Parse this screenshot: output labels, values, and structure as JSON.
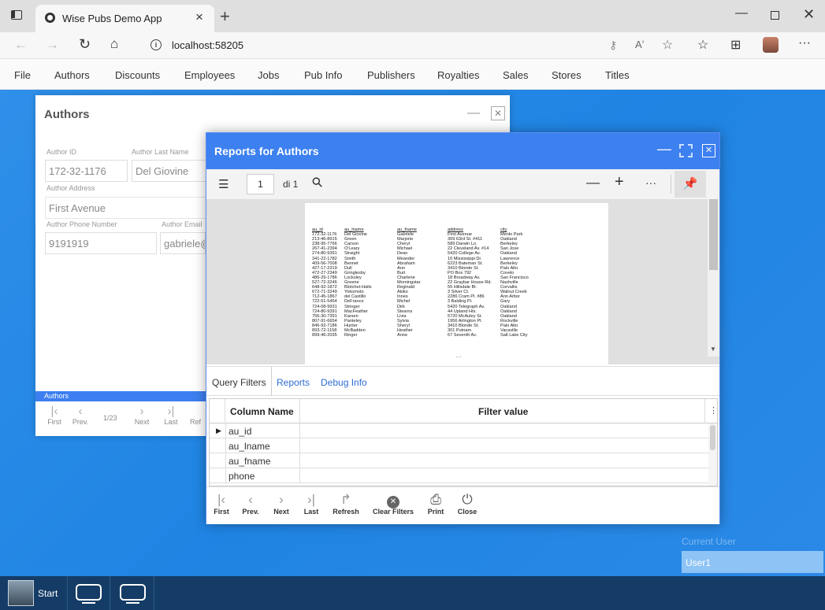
{
  "browser": {
    "tab_title": "Wise Pubs Demo App",
    "url": "localhost:58205"
  },
  "menu": [
    "File",
    "Authors",
    "Discounts",
    "Employees",
    "Jobs",
    "Pub Info",
    "Publishers",
    "Royalties",
    "Sales",
    "Stores",
    "Titles"
  ],
  "authors_window": {
    "title": "Authors",
    "labels": {
      "id": "Author ID",
      "lname": "Author Last Name",
      "address": "Author Address",
      "phone": "Author Phone Number",
      "email": "Author Email"
    },
    "values": {
      "id": "172-32-1176",
      "lname": "Del Giovine",
      "address": "First Avenue",
      "phone": "9191919",
      "email": "gabriele@"
    },
    "grid_caption": "Authors",
    "nav": {
      "first": "First",
      "prev": "Prev.",
      "counter": "1/23",
      "next": "Next",
      "last": "Last",
      "refresh": "Ref"
    }
  },
  "report_window": {
    "title": "Reports for Authors",
    "page_number": "1",
    "page_of": "di 1",
    "tabs": [
      "Query Filters",
      "Reports",
      "Debug Info"
    ],
    "grid_headers": {
      "col1": "Column Name",
      "col2": "Filter value"
    },
    "grid_rows": [
      "au_id",
      "au_lname",
      "au_fname",
      "phone"
    ],
    "buttons": {
      "first": "First",
      "prev": "Prev.",
      "next": "Next",
      "last": "Last",
      "refresh": "Refresh",
      "clear": "Clear Filters",
      "print": "Print",
      "close": "Close"
    }
  },
  "report_document": {
    "headers": [
      "au_id",
      "au_lname",
      "au_fname",
      "address",
      "city"
    ],
    "au_id": [
      "172-32-1176",
      "213-46-8915",
      "238-95-7766",
      "267-41-2394",
      "274-80-9391",
      "341-22-1782",
      "409-56-7008",
      "427-17-2319",
      "472-27-2349",
      "486-29-1786",
      "527-72-3246",
      "648-92-1872",
      "672-71-3249",
      "712-45-1867",
      "722-51-5454",
      "724-08-9931",
      "724-80-9391",
      "756-30-7391",
      "807-91-6654",
      "846-92-7186",
      "893-72-1158",
      "899-46-2035"
    ],
    "au_lname": [
      "Del Giovine",
      "Green",
      "Carson",
      "O'Leary",
      "Straight",
      "Smith",
      "Bennet",
      "Dull",
      "Gringlesby",
      "Locksley",
      "Greene",
      "Blotchet-Halls",
      "Yokomoto",
      "del Castillo",
      "DeFrance",
      "Stringer",
      "MacFeather",
      "Karsen",
      "Panteley",
      "Hunter",
      "McBadden",
      "Ringer"
    ],
    "au_fname": [
      "Gabriele",
      "Marjorie",
      "Cheryl",
      "Michael",
      "Dean",
      "Meander",
      "Abraham",
      "Ann",
      "Burt",
      "Charlene",
      "Morningstar",
      "Reginald",
      "Akiko",
      "Innes",
      "Michel",
      "Dirk",
      "Stearns",
      "Livia",
      "Sylvia",
      "Sheryl",
      "Heather",
      "Anne"
    ],
    "address": [
      "First Avenue",
      "309 63rd St. #411",
      "589 Darwin Ln.",
      "22 Cleveland Av. #14",
      "5420 College Av.",
      "10 Mississippi Dr.",
      "6223 Bateman St.",
      "3410 Blonde St.",
      "PO Box 792",
      "18 Broadway Av.",
      "22 Graybar House Rd.",
      "55 Hillsdale Bl.",
      "3 Silver Ct.",
      "2286 Cram Pl. #86",
      "3 Balding Pl.",
      "5420 Telegraph Av.",
      "44 Upland Hts.",
      "5720 McAuley St.",
      "1956 Arlington Pl.",
      "3410 Blonde St.",
      "301 Putnam",
      "67 Seventh Av."
    ],
    "city": [
      "Menlo Park",
      "Oakland",
      "Berkeley",
      "San Jose",
      "Oakland",
      "Lawrence",
      "Berkeley",
      "Palo Alto",
      "Covelo",
      "San Francisco",
      "Nashville",
      "Corvallis",
      "Walnut Creek",
      "Ann Arbor",
      "Gary",
      "Oakland",
      "Oakland",
      "Oakland",
      "Rockville",
      "Palo Alto",
      "Vacaville",
      "Salt Lake City"
    ]
  },
  "current_user": {
    "label": "Current User",
    "value": "User1"
  },
  "taskbar": {
    "start_label": "Start"
  }
}
